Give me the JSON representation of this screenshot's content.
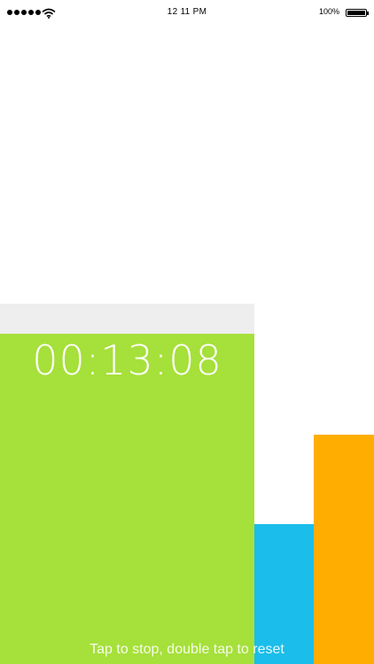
{
  "status_bar": {
    "time": "12 11 PM",
    "battery_percent": "100%",
    "signal_icon": "signal-dots-icon",
    "wifi_icon": "wifi-icon",
    "battery_icon": "battery-icon"
  },
  "stopwatch": {
    "elapsed": "00:13:08",
    "hint": "Tap to stop, double tap to reset"
  },
  "colors": {
    "green": "#a6e03a",
    "blue": "#1bbdea",
    "orange": "#ffad00",
    "track": "#eeeeee"
  }
}
